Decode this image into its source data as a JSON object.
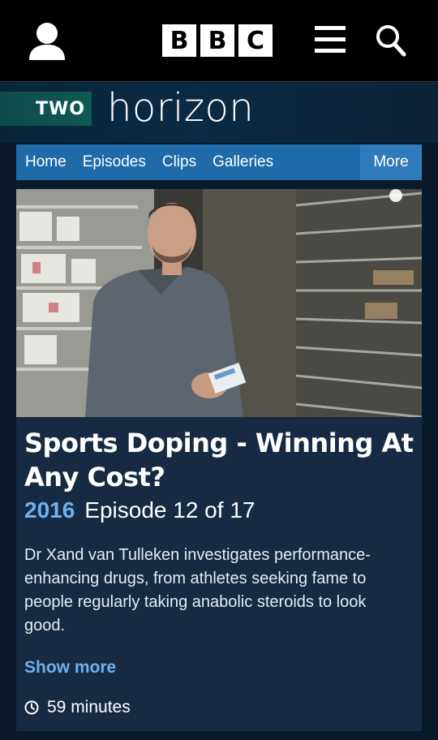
{
  "header": {
    "logo_letters": [
      "B",
      "B",
      "C"
    ],
    "icons": {
      "account": "user-icon",
      "menu": "menu-icon",
      "search": "search-icon"
    }
  },
  "brand": {
    "channel": "TWO",
    "programme": "horizon"
  },
  "nav": {
    "items": [
      "Home",
      "Episodes",
      "Clips",
      "Galleries"
    ],
    "more_label": "More"
  },
  "episode": {
    "title": "Sports Doping - Winning At Any Cost?",
    "year": "2016",
    "episode_label": "Episode 12 of 17",
    "synopsis": "Dr Xand van Tulleken investigates performance-enhancing drugs, from athletes seeking fame to people regularly taking anabolic steroids to look good.",
    "show_more_label": "Show more",
    "duration": "59 minutes"
  },
  "colors": {
    "nav_bg": "#1f6aa8",
    "nav_more_bg": "#2f7bbb",
    "accent_blue": "#6fb1ef",
    "card_bg": "#172a43",
    "page_bg": "#0b1a2b"
  }
}
